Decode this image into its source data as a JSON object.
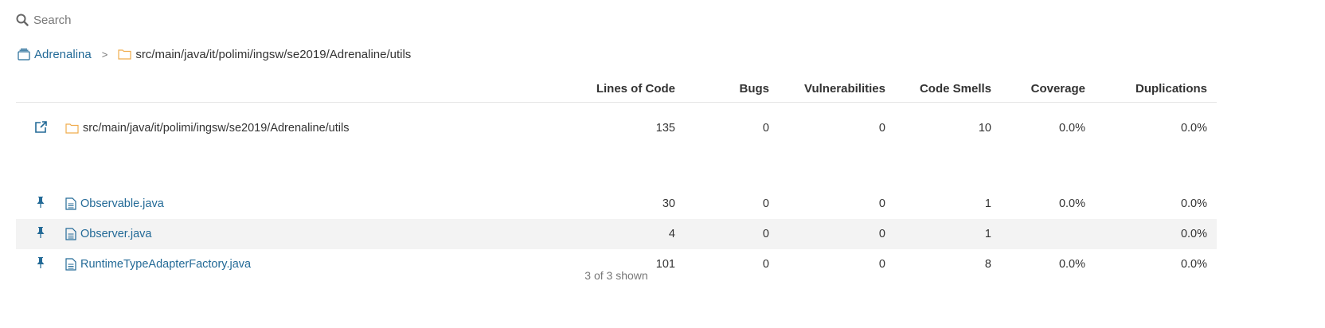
{
  "search": {
    "placeholder": "Search"
  },
  "breadcrumb": {
    "project": "Adrenalina",
    "separator": ">",
    "path": "src/main/java/it/polimi/ingsw/se2019/Adrenaline/utils"
  },
  "table": {
    "columns": [
      "Lines of Code",
      "Bugs",
      "Vulnerabilities",
      "Code Smells",
      "Coverage",
      "Duplications"
    ],
    "directory": {
      "name": "src/main/java/it/polimi/ingsw/se2019/Adrenaline/utils",
      "loc": "135",
      "bugs": "0",
      "vulnerabilities": "0",
      "code_smells": "10",
      "coverage": "0.0%",
      "duplications": "0.0%"
    },
    "files": [
      {
        "name": "Observable.java",
        "loc": "30",
        "bugs": "0",
        "vulnerabilities": "0",
        "code_smells": "1",
        "coverage": "0.0%",
        "duplications": "0.0%"
      },
      {
        "name": "Observer.java",
        "loc": "4",
        "bugs": "0",
        "vulnerabilities": "0",
        "code_smells": "1",
        "coverage": "",
        "duplications": "0.0%"
      },
      {
        "name": "RuntimeTypeAdapterFactory.java",
        "loc": "101",
        "bugs": "0",
        "vulnerabilities": "0",
        "code_smells": "8",
        "coverage": "0.0%",
        "duplications": "0.0%"
      }
    ]
  },
  "footer": {
    "shown": "3 of 3 shown"
  },
  "colors": {
    "link": "#236a97",
    "folder": "#f0ad4e",
    "row_alt": "#f3f3f3",
    "muted": "#777777"
  },
  "icons": [
    "search-icon",
    "project-icon",
    "folder-icon",
    "external-link-icon",
    "pin-icon",
    "file-icon"
  ]
}
